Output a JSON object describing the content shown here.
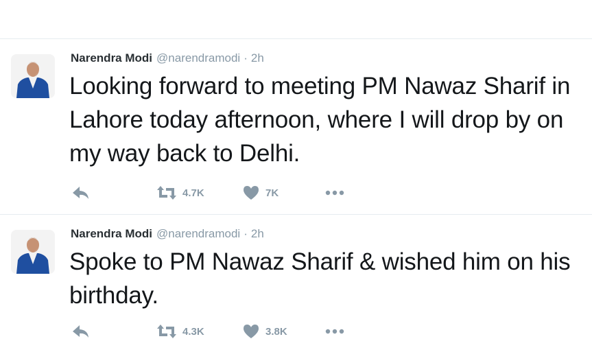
{
  "tweets": [
    {
      "name": "Narendra Modi",
      "handle": "@narendramodi",
      "separator": "·",
      "time": "2h",
      "text": "Looking forward to meeting PM Nawaz Sharif in Lahore today afternoon, where I will drop by on my way back to Delhi.",
      "retweets": "4.7K",
      "likes": "7K"
    },
    {
      "name": "Narendra Modi",
      "handle": "@narendramodi",
      "separator": "·",
      "time": "2h",
      "text": "Spoke to PM Nawaz Sharif & wished him on his birthday.",
      "retweets": "4.3K",
      "likes": "3.8K"
    }
  ],
  "icons": {
    "reply": "reply-icon",
    "retweet": "retweet-icon",
    "like": "heart-icon",
    "more": "more-icon"
  },
  "colors": {
    "text": "#14171a",
    "muted": "#8899a6",
    "vest": "#1f4fa0",
    "divider": "#e6ecf0"
  }
}
